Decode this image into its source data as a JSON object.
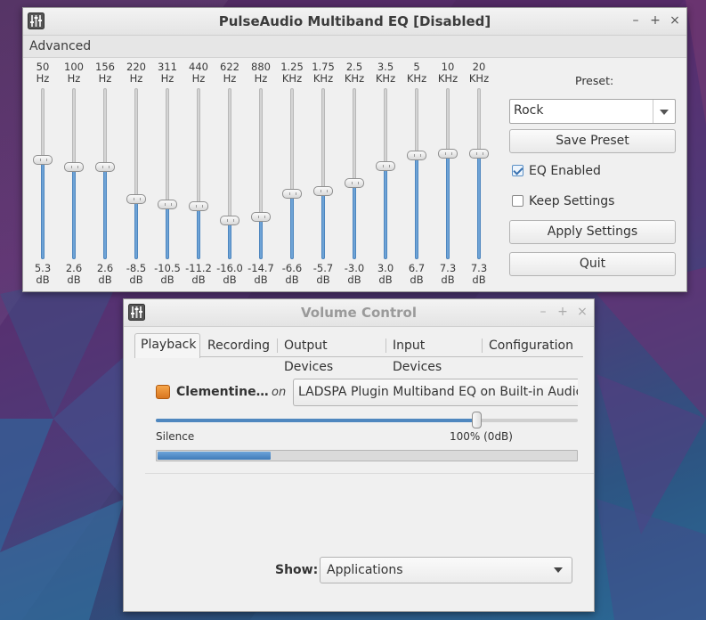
{
  "eq_window": {
    "title": "PulseAudio Multiband EQ [Disabled]",
    "menu": [
      "Advanced"
    ],
    "bands": [
      {
        "freq": "50",
        "unit": "Hz",
        "gain": 5.3,
        "gain_text": "5.3",
        "db": "dB"
      },
      {
        "freq": "100",
        "unit": "Hz",
        "gain": 2.6,
        "gain_text": "2.6",
        "db": "dB"
      },
      {
        "freq": "156",
        "unit": "Hz",
        "gain": 2.6,
        "gain_text": "2.6",
        "db": "dB"
      },
      {
        "freq": "220",
        "unit": "Hz",
        "gain": -8.5,
        "gain_text": "-8.5",
        "db": "dB"
      },
      {
        "freq": "311",
        "unit": "Hz",
        "gain": -10.5,
        "gain_text": "-10.5",
        "db": "dB"
      },
      {
        "freq": "440",
        "unit": "Hz",
        "gain": -11.2,
        "gain_text": "-11.2",
        "db": "dB"
      },
      {
        "freq": "622",
        "unit": "Hz",
        "gain": -16.0,
        "gain_text": "-16.0",
        "db": "dB"
      },
      {
        "freq": "880",
        "unit": "Hz",
        "gain": -14.7,
        "gain_text": "-14.7",
        "db": "dB"
      },
      {
        "freq": "1.25",
        "unit": "KHz",
        "gain": -6.6,
        "gain_text": "-6.6",
        "db": "dB"
      },
      {
        "freq": "1.75",
        "unit": "KHz",
        "gain": -5.7,
        "gain_text": "-5.7",
        "db": "dB"
      },
      {
        "freq": "2.5",
        "unit": "KHz",
        "gain": -3.0,
        "gain_text": "-3.0",
        "db": "dB"
      },
      {
        "freq": "3.5",
        "unit": "KHz",
        "gain": 3.0,
        "gain_text": "3.0",
        "db": "dB"
      },
      {
        "freq": "5",
        "unit": "KHz",
        "gain": 6.7,
        "gain_text": "6.7",
        "db": "dB"
      },
      {
        "freq": "10",
        "unit": "KHz",
        "gain": 7.3,
        "gain_text": "7.3",
        "db": "dB"
      },
      {
        "freq": "20",
        "unit": "KHz",
        "gain": 7.3,
        "gain_text": "7.3",
        "db": "dB"
      }
    ],
    "gain_range": [
      -30,
      30
    ],
    "preset_label": "Preset:",
    "preset_value": "Rock",
    "save_preset": "Save Preset",
    "eq_enabled_label": "EQ Enabled",
    "eq_enabled": true,
    "keep_settings_label": "Keep Settings",
    "keep_settings": false,
    "apply_settings": "Apply Settings",
    "quit": "Quit"
  },
  "volume_window": {
    "title": "Volume Control",
    "tabs": [
      "Playback",
      "Recording",
      "Output Devices",
      "Input Devices",
      "Configuration"
    ],
    "active_tab": "Playback",
    "stream": {
      "app_name": "Clementine ...",
      "on_label": "on",
      "sink": "LADSPA Plugin Multiband EQ on Built-in Audio",
      "volume": 0.76,
      "silence_label": "Silence",
      "volume_text": "100% (0dB)",
      "peak_level": 0.27
    },
    "show_label": "Show:",
    "show_value": "Applications"
  },
  "colors": {
    "accent": "#4f87bf",
    "eq_fill": "#6ea3d6",
    "window_bg": "#f0f0f0"
  }
}
